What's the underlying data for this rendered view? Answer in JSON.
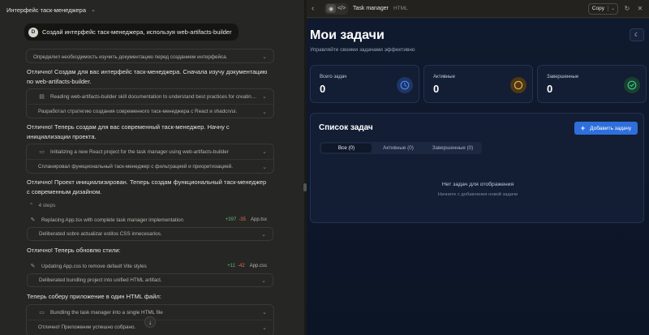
{
  "chat": {
    "title": "Интерфейс таск-менеджера",
    "user_message": "Создай интерфейс таск-менеджера, используя web-artifacts-builder",
    "user_initial": "D",
    "thought1": "Определил необходимость изучить документацию перед созданием интерфейса.",
    "para1": "Отлично! Создам для вас интерфейс таск-менеджера. Сначала изучу документацию по web-artifacts-builder.",
    "box1_row1": "Reading web-artifacts-builder skill documentation to understand best practices for creating com...",
    "box1_row2": "Разработал стратегию создания современного таск-менеджера с React и shadcn/ui.",
    "para2": "Отлично! Теперь создам для вас современный таск-менеджер. Начну с инициализации проекта.",
    "box2_row1": "Initializing a new React project for the task manager using web-artifacts-builder",
    "box2_row2": "Спланировал функциональный таск-менеджер с фильтрацией и приоритизацией.",
    "para3": "Отлично! Проект инициализирован. Теперь создам функциональный таск-менеджер с современным дизайном.",
    "steps": "4 steps",
    "box3_row1": "Replacing App.tsx with complete task manager implementation",
    "box3_add": "+397",
    "box3_del": "-35",
    "box3_file": "App.tsx",
    "box3_row2": "Deliberated sobre actualizar estilos CSS innecesarios.",
    "para4": "Отлично! Теперь обновлю стили:",
    "box4_row1": "Updating App.css to remove default Vite styles",
    "box4_add": "+11",
    "box4_del": "-42",
    "box4_file": "App.css",
    "box4_row2": "Deliberated bundling project into unified HTML artifact.",
    "para5": "Теперь соберу приложение в один HTML файл:",
    "box5_row1": "Bundling the task manager into a single HTML file",
    "box5_row2": "Отлично! Приложение успешно собрано."
  },
  "artifact": {
    "title": "Task manager",
    "type": "HTML",
    "copy_label": "Copy"
  },
  "app": {
    "title": "Мои задачи",
    "subtitle": "Управляйте своими задачами эффективно",
    "stats": [
      {
        "label": "Всего задач",
        "value": "0",
        "color": "#3b6fd8"
      },
      {
        "label": "Активные",
        "value": "0",
        "color": "#e0a33a"
      },
      {
        "label": "Завершенные",
        "value": "0",
        "color": "#3fbf7f"
      }
    ],
    "list_title": "Список задач",
    "add_label": "Добавить задачу",
    "tabs": [
      "Все (0)",
      "Активные (0)",
      "Завершенные (0)"
    ],
    "empty_main": "Нет задач для отображения",
    "empty_sub": "Начните с добавления новой задачи"
  }
}
